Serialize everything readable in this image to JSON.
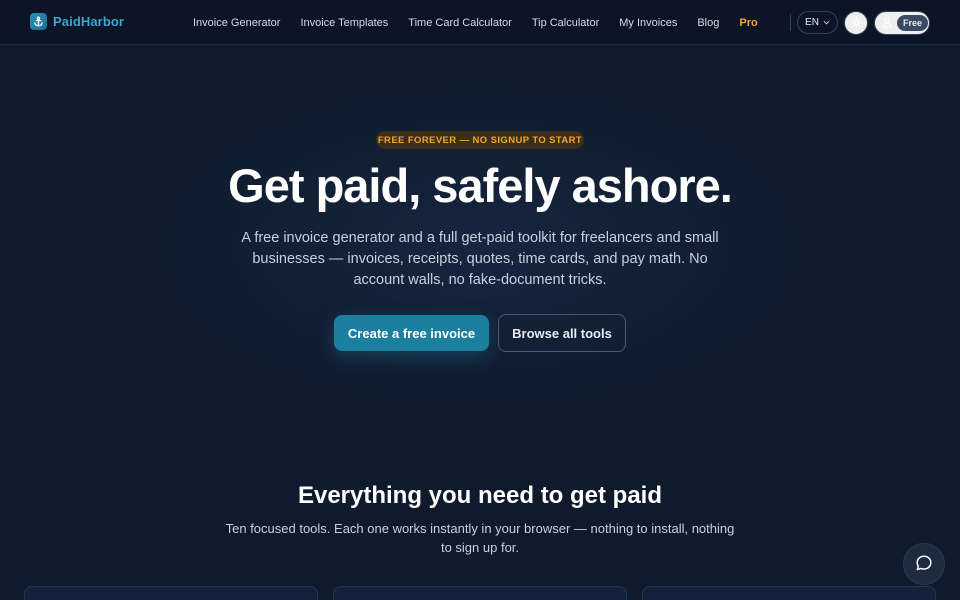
{
  "brand": {
    "name": "PaidHarbor",
    "accent": "#1b7fa0",
    "pro_color": "#f0a62a"
  },
  "nav": {
    "links": [
      {
        "label": "Invoice Generator"
      },
      {
        "label": "Invoice Templates"
      },
      {
        "label": "Time Card Calculator"
      },
      {
        "label": "Tip Calculator"
      },
      {
        "label": "My Invoices"
      },
      {
        "label": "Blog"
      },
      {
        "label": "Pro"
      }
    ],
    "language": "EN",
    "theme_icon": "sun-icon",
    "account_icon": "user-icon",
    "plan": "Free"
  },
  "hero": {
    "badge": "FREE FOREVER — NO SIGNUP TO START",
    "title": "Get paid, safely ashore.",
    "subtitle": "A free invoice generator and a full get-paid toolkit for freelancers and small businesses — invoices, receipts, quotes, time cards, and pay math. No account walls, no fake-document tricks.",
    "primary_cta": "Create a free invoice",
    "secondary_cta": "Browse all tools"
  },
  "tools_section": {
    "title": "Everything you need to get paid",
    "subtitle": "Ten focused tools. Each one works instantly in your browser — nothing to install, nothing to sign up for."
  },
  "chat": {
    "icon": "chat-bubble-icon"
  }
}
